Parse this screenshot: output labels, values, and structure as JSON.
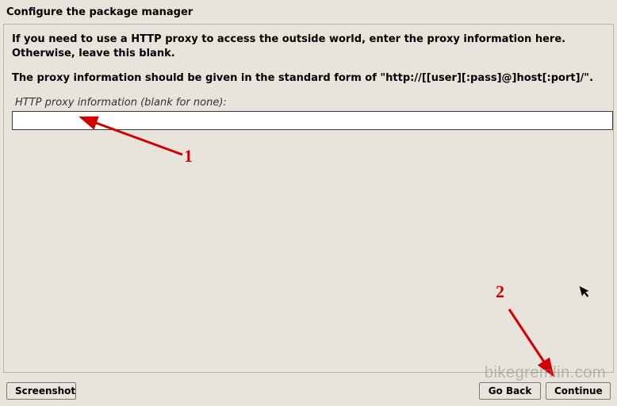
{
  "title": "Configure the package manager",
  "panel": {
    "para1": "If you need to use a HTTP proxy to access the outside world, enter the proxy information here. Otherwise, leave this blank.",
    "para2": "The proxy information should be given in the standard form of \"http://[[user][:pass]@]host[:port]/\".",
    "field_label": "HTTP proxy information (blank for none):",
    "proxy_value": ""
  },
  "buttons": {
    "screenshot": "Screenshot",
    "go_back": "Go Back",
    "continue": "Continue"
  },
  "annotations": {
    "marker1": "1",
    "marker2": "2"
  },
  "watermark": "bikegremlin.com"
}
